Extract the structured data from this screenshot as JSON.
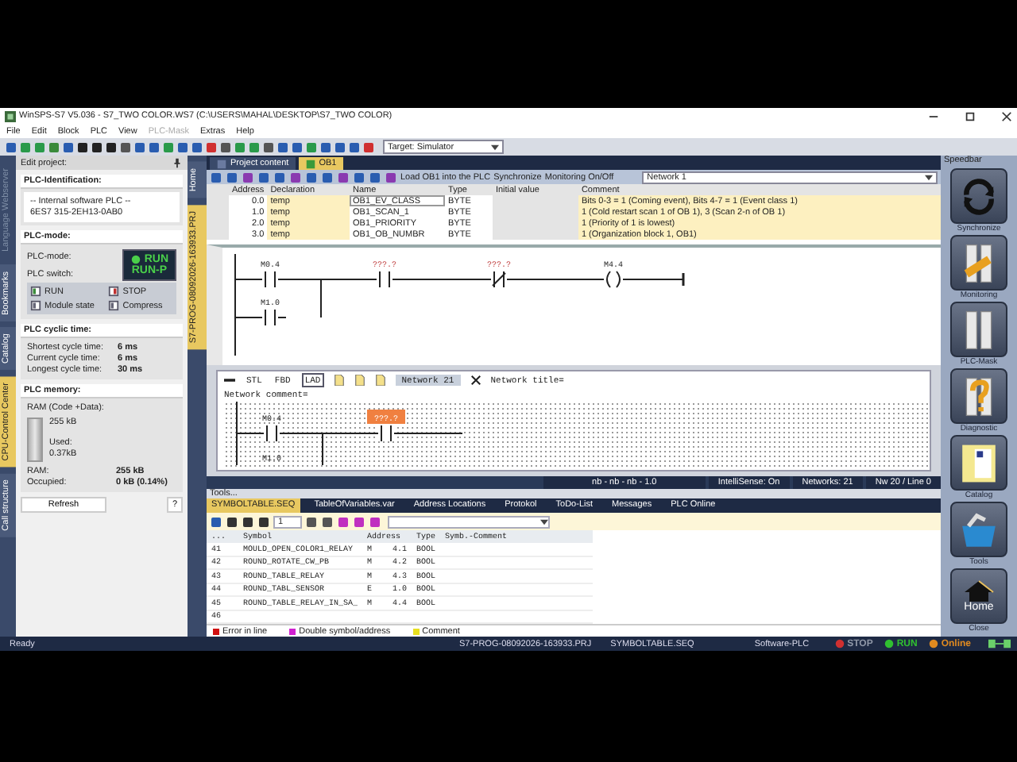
{
  "window": {
    "title": "WinSPS-S7 V5.036 - S7_TWO COLOR.WS7 (C:\\USERS\\MAHAL\\DESKTOP\\S7_TWO COLOR)"
  },
  "menu": [
    {
      "label": "File",
      "disabled": false
    },
    {
      "label": "Edit",
      "disabled": false
    },
    {
      "label": "Block",
      "disabled": false
    },
    {
      "label": "PLC",
      "disabled": false
    },
    {
      "label": "View",
      "disabled": false
    },
    {
      "label": "PLC-Mask",
      "disabled": true
    },
    {
      "label": "Extras",
      "disabled": false
    },
    {
      "label": "Help",
      "disabled": false
    }
  ],
  "toolbar": {
    "target": "Target: Simulator"
  },
  "left_tabs": [
    {
      "label": "Language Webserver",
      "selected": false,
      "disabled": true
    },
    {
      "label": "Bookmarks",
      "selected": false,
      "disabled": false
    },
    {
      "label": "Catalog",
      "selected": false,
      "disabled": false
    },
    {
      "label": "CPU-Control Center",
      "selected": true,
      "disabled": false
    },
    {
      "label": "Call structure",
      "selected": false,
      "disabled": false
    }
  ],
  "plc_panel": {
    "header": "Edit project:",
    "identification": {
      "title": "PLC-Identification:",
      "lines": [
        "-- Internal software PLC --",
        "6ES7 315-2EH13-0AB0"
      ]
    },
    "mode": {
      "title": "PLC-mode:",
      "mode_label": "PLC-mode:",
      "switch_label": "PLC switch:",
      "mode_value": "RUN",
      "switch_value": "RUN-P",
      "buttons": [
        {
          "label": "RUN",
          "kind": "run"
        },
        {
          "label": "STOP",
          "kind": "stop"
        },
        {
          "label": "Module state",
          "kind": "module"
        },
        {
          "label": "Compress",
          "kind": "compress"
        }
      ]
    },
    "cycle": {
      "title": "PLC cyclic time:",
      "rows": [
        {
          "label": "Shortest cycle time:",
          "value": "6 ms"
        },
        {
          "label": "Current cycle time:",
          "value": "6 ms"
        },
        {
          "label": "Longest cycle time:",
          "value": "30 ms"
        }
      ]
    },
    "memory": {
      "title": "PLC memory:",
      "caption": "RAM (Code +Data):",
      "total": "255 kB",
      "used_label": "Used:",
      "used": "0.37kB",
      "level": 0.0014,
      "rows": [
        {
          "label": "RAM:",
          "value": "255 kB"
        },
        {
          "label": "Occupied:",
          "value": "0 kB (0.14%)"
        }
      ]
    },
    "refresh": "Refresh",
    "help": "?"
  },
  "center_tabs": [
    {
      "label": "Home",
      "selected": false
    },
    {
      "label": "S7-PROG-08092026-163933.PRJ",
      "selected": true
    }
  ],
  "editor_tabs": [
    {
      "label": "Project content",
      "selected": false
    },
    {
      "label": "OB1",
      "selected": true
    }
  ],
  "editor_toolbar": {
    "load": "Load OB1 into the PLC",
    "sync": "Synchronize",
    "monitor": "Monitoring On/Off",
    "network": "Network 1"
  },
  "declarations": {
    "columns": [
      "Address",
      "Declaration",
      "Name",
      "Type",
      "Initial value",
      "Comment"
    ],
    "rows": [
      {
        "address": "0.0",
        "declaration": "temp",
        "name": "OB1_EV_CLASS",
        "type": "BYTE",
        "comment": "Bits 0-3 = 1 (Coming event), Bits 4-7 = 1 (Event class 1)"
      },
      {
        "address": "1.0",
        "declaration": "temp",
        "name": "OB1_SCAN_1",
        "type": "BYTE",
        "comment": "1 (Cold restart scan 1 of OB 1), 3 (Scan 2-n of OB 1)"
      },
      {
        "address": "2.0",
        "declaration": "temp",
        "name": "OB1_PRIORITY",
        "type": "BYTE",
        "comment": "1 (Priority of 1 is lowest)"
      },
      {
        "address": "3.0",
        "declaration": "temp",
        "name": "OB1_OB_NUMBR",
        "type": "BYTE",
        "comment": "1 (Organization block 1, OB1)"
      }
    ]
  },
  "network_1": {
    "rung": [
      {
        "address": "M0.4",
        "kind": "no",
        "unknown": false
      },
      {
        "address": "???.?",
        "kind": "no",
        "unknown": true
      },
      {
        "address": "???.?",
        "kind": "nc",
        "unknown": true
      },
      {
        "address": "M4.4",
        "kind": "coil",
        "unknown": false
      }
    ],
    "branch": [
      {
        "address": "M1.0",
        "kind": "no"
      }
    ]
  },
  "network_21": {
    "views": [
      {
        "label": "STL",
        "selected": false
      },
      {
        "label": "FBD",
        "selected": false
      },
      {
        "label": "LAD",
        "selected": true
      }
    ],
    "number": "Network 21",
    "title": "Network title=",
    "comment": "Network comment=",
    "rung": [
      {
        "address": "M0.4",
        "highlighted": false
      },
      {
        "address": "???.?",
        "highlighted": true
      }
    ],
    "branch": [
      {
        "address": "M1.0"
      }
    ]
  },
  "editor_status": [
    "nb - nb - nb - 1.0",
    "IntelliSense: On",
    "Networks: 21",
    "Nw 20 / Line 0"
  ],
  "tools": {
    "header": "Tools...",
    "tabs": [
      {
        "label": "SYMBOLTABLE.SEQ",
        "selected": true
      },
      {
        "label": "TableOfVariables.var",
        "selected": false
      },
      {
        "label": "Address Locations",
        "selected": false
      },
      {
        "label": "Protokol",
        "selected": false
      },
      {
        "label": "ToDo-List",
        "selected": false
      },
      {
        "label": "Messages",
        "selected": false
      },
      {
        "label": "PLC Online",
        "selected": false
      }
    ],
    "spinner": "1",
    "columns": [
      "...",
      "Symbol",
      "Address",
      "Type",
      "Symb.-Comment"
    ],
    "rows": [
      {
        "no": "41",
        "symbol": "MOULD_OPEN_COLOR1_RELAY",
        "area": "M",
        "address": "4.1",
        "type": "BOOL"
      },
      {
        "no": "42",
        "symbol": "ROUND_ROTATE_CW_PB",
        "area": "M",
        "address": "4.2",
        "type": "BOOL"
      },
      {
        "no": "43",
        "symbol": "ROUND_TABLE_RELAY",
        "area": "M",
        "address": "4.3",
        "type": "BOOL"
      },
      {
        "no": "44",
        "symbol": "ROUND_TABL_SENSOR",
        "area": "E",
        "address": "1.0",
        "type": "BOOL"
      },
      {
        "no": "45",
        "symbol": "ROUND_TABLE_RELAY_IN_SA_",
        "area": "M",
        "address": "4.4",
        "type": "BOOL"
      },
      {
        "no": "46"
      }
    ],
    "legend": [
      {
        "label": "Error in line",
        "color": "#d01010"
      },
      {
        "label": "Double symbol/address",
        "color": "#d020d0"
      },
      {
        "label": "Comment",
        "color": "#e8e020"
      }
    ]
  },
  "speedbar": {
    "title": "Speedbar",
    "items": [
      {
        "label": "Synchronize",
        "kind": "sync"
      },
      {
        "label": "Monitoring",
        "kind": "monitor"
      },
      {
        "label": "PLC-Mask",
        "kind": "mask"
      },
      {
        "label": "Diagnostic",
        "kind": "diag"
      },
      {
        "label": "Catalog",
        "kind": "catalog"
      },
      {
        "label": "Tools",
        "kind": "tools"
      },
      {
        "label": "Close",
        "kind": "home",
        "text": "Home"
      }
    ]
  },
  "status_bar": {
    "fields": [
      "Ready",
      "S7-PROG-08092026-163933.PRJ",
      "SYMBOLTABLE.SEQ",
      "Software-PLC"
    ],
    "leds": [
      {
        "label": "STOP",
        "on": false,
        "color": "#d03030"
      },
      {
        "label": "RUN",
        "on": true,
        "color": "#30c030"
      },
      {
        "label": "Online",
        "on": true,
        "color": "#e08a20"
      }
    ]
  }
}
